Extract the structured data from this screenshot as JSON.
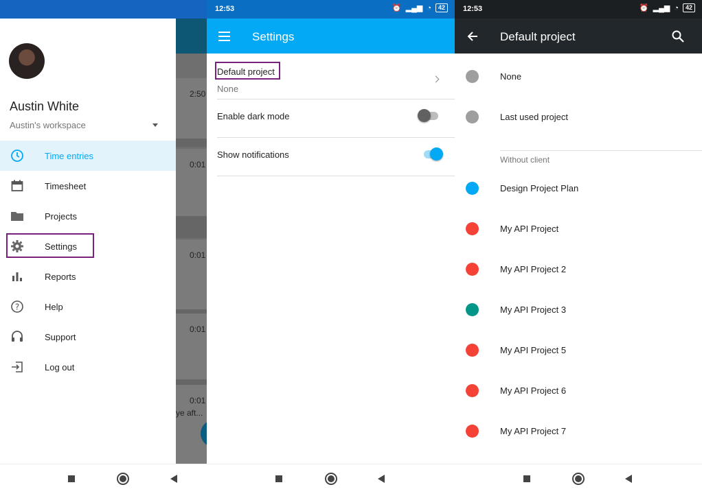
{
  "panel1": {
    "drawer": {
      "user_name": "Austin White",
      "workspace": "Austin's workspace",
      "items": [
        {
          "label": "Time entries",
          "icon": "clock-icon",
          "active": true
        },
        {
          "label": "Timesheet",
          "icon": "calendar-icon",
          "active": false
        },
        {
          "label": "Projects",
          "icon": "folder-icon",
          "active": false
        },
        {
          "label": "Settings",
          "icon": "gear-icon",
          "active": false
        },
        {
          "label": "Reports",
          "icon": "bar-chart-icon",
          "active": false
        },
        {
          "label": "Help",
          "icon": "help-icon",
          "active": false
        },
        {
          "label": "Support",
          "icon": "headset-icon",
          "active": false
        },
        {
          "label": "Log out",
          "icon": "logout-icon",
          "active": false
        }
      ]
    },
    "background_entries": [
      "2:50",
      "0:01",
      "0:01",
      "0:01",
      "0:01"
    ],
    "background_partial_text": "ye aft..."
  },
  "panel2": {
    "time": "12:53",
    "battery": "42",
    "title": "Settings",
    "default_project": {
      "label": "Default project",
      "value": "None"
    },
    "dark_mode": {
      "label": "Enable dark mode",
      "on": false
    },
    "notifications": {
      "label": "Show notifications",
      "on": true
    }
  },
  "panel3": {
    "time": "12:53",
    "battery": "42",
    "title": "Default project",
    "top_options": [
      {
        "name": "None",
        "color": "#9e9e9e"
      },
      {
        "name": "Last used project",
        "color": "#9e9e9e"
      }
    ],
    "section": "Without client",
    "projects": [
      {
        "name": "Design Project Plan",
        "color": "#03a9f4"
      },
      {
        "name": "My API Project",
        "color": "#f44336"
      },
      {
        "name": "My API Project 2",
        "color": "#f44336"
      },
      {
        "name": "My API Project 3",
        "color": "#009688"
      },
      {
        "name": "My API Project 5",
        "color": "#f44336"
      },
      {
        "name": "My API Project 6",
        "color": "#f44336"
      },
      {
        "name": "My API Project 7",
        "color": "#f44336"
      }
    ]
  },
  "colors": {
    "accent": "#03a9f4",
    "highlight": "#7b1f7e",
    "dark_appbar": "#22272b"
  }
}
